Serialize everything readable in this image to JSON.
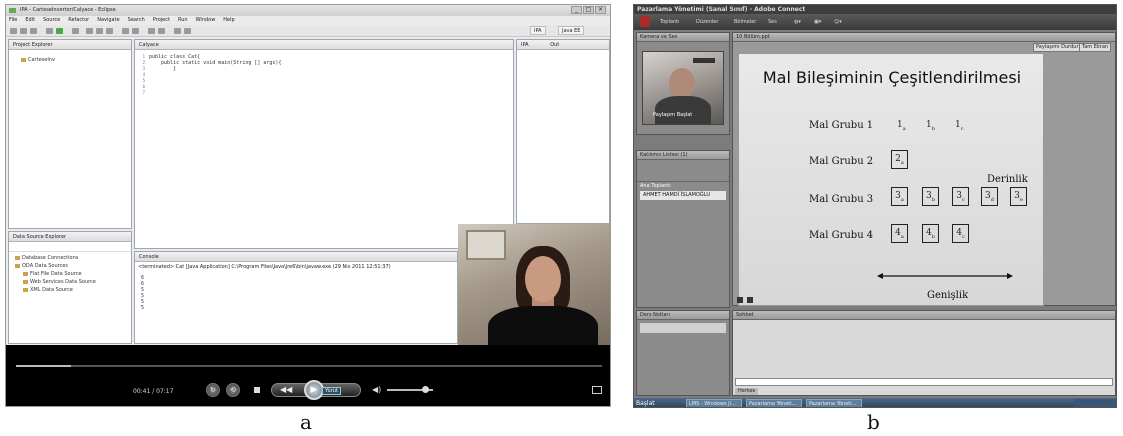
{
  "captions": {
    "a": "a",
    "b": "b"
  },
  "eclipse": {
    "title": "IPA - CarteseInvertor/Calyace - Eclipse",
    "menu": [
      "File",
      "Edit",
      "Source",
      "Refactor",
      "Navigate",
      "Search",
      "Project",
      "Run",
      "Window",
      "Help"
    ],
    "perspectives": [
      "IPA",
      "Java EE"
    ],
    "project_explorer": {
      "tab": "Project Explorer",
      "project": "CarteseInv"
    },
    "editor": {
      "tab": "Calyace",
      "code_lines": [
        "",
        "",
        "public class Cat{",
        "    public static void main(String [] args){",
        "",
        "        }",
        ""
      ],
      "line_numbers": [
        "1",
        "2",
        "3",
        "4",
        "5",
        "6",
        "7"
      ]
    },
    "outline_tabs": [
      "IPA",
      "Out"
    ],
    "data_source": {
      "tab": "Data Source Explorer",
      "items": [
        "Database Connections",
        "ODA Data Sources",
        "Flat File Data Source",
        "Web Services Data Source",
        "XML Data Source"
      ]
    },
    "console": {
      "tab": "Console",
      "header": "<terminated> Cat [Java Application] C:\\Program Files\\Java\\jre6\\bin\\javaw.exe (29 Nis 2011 12:51:37)",
      "output": [
        "6",
        "6",
        "5",
        "5",
        "5",
        "5"
      ]
    }
  },
  "player": {
    "time": "00:41 / 07:17",
    "progress_fraction": 0.094,
    "volume_fraction": 0.82,
    "play_tooltip": "Yürüt"
  },
  "connect": {
    "title": "Pazarlama Yönetimi (Sanal Sınıf) - Adobe Connect",
    "menu": [
      "Toplantı",
      "Düzenler",
      "Bölmeler",
      "Ses"
    ],
    "camera_pod": {
      "title": "Kamera ve Ses",
      "name_tag": "Paylaşım Başlat"
    },
    "attendees_pod": {
      "title": "Katılımcı Listesi (1)",
      "section": "Ana Toplantı",
      "person": "AHMET HAMDİ İSLAMOĞLU"
    },
    "chat_pod": {
      "title": "Ders Notları"
    },
    "sohbet_pod": {
      "title": "Sohbet",
      "tab": "Herkes"
    },
    "share_pod": {
      "title": "10 Bölüm.ppt",
      "buttons": [
        "Paylaşımı Durdur",
        "Tam Ekran"
      ]
    },
    "slide": {
      "title": "Mal Bileşiminin Çeşitlendirilmesi",
      "rows": [
        "Mal Grubu 1",
        "Mal Grubu 2",
        "Mal Grubu 3",
        "Mal Grubu 4"
      ],
      "row1": [
        {
          "b": "1",
          "s": "a"
        },
        {
          "b": "1",
          "s": "b"
        },
        {
          "b": "1",
          "s": "c"
        }
      ],
      "row2": [
        {
          "b": "2",
          "s": "a"
        }
      ],
      "row3": [
        {
          "b": "3",
          "s": "a"
        },
        {
          "b": "3",
          "s": "b"
        },
        {
          "b": "3",
          "s": "c"
        },
        {
          "b": "3",
          "s": "d"
        },
        {
          "b": "3",
          "s": "e"
        }
      ],
      "row4": [
        {
          "b": "4",
          "s": "a"
        },
        {
          "b": "4",
          "s": "b"
        },
        {
          "b": "4",
          "s": "c"
        }
      ],
      "depth_label": "Derinlik",
      "width_label": "Genişlik"
    },
    "taskbar": {
      "start": "Başlat",
      "tasks": [
        "LMS - Windows Ji...",
        "Pazarlama Yöneti...",
        "Pazarlama Yöneti..."
      ]
    }
  },
  "colors": {
    "eclipse_bg": "#ebebeb",
    "connect_bg": "#7c7c7c",
    "player_bg": "#000000"
  }
}
